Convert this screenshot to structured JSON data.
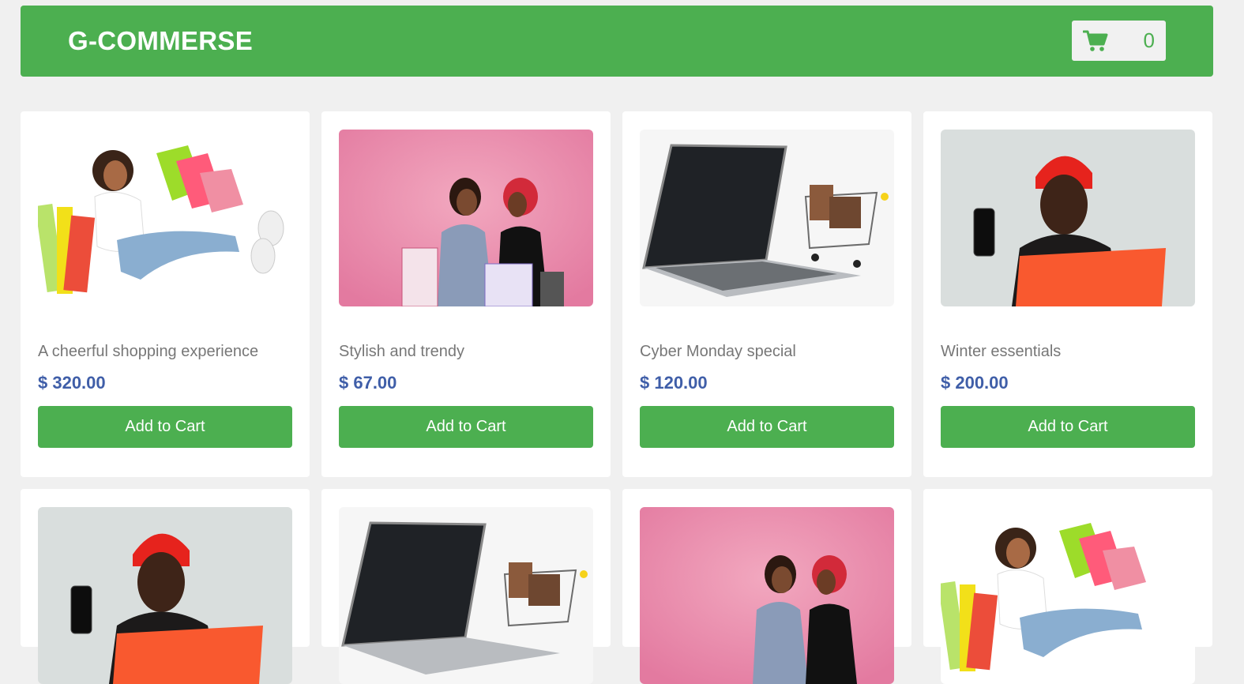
{
  "header": {
    "brand": "G-COMMERSE",
    "cart_icon": "shopping-cart-icon",
    "cart_count": "0"
  },
  "colors": {
    "primary": "#4caf50",
    "price": "#3f5ea8",
    "background": "#f0f0f0",
    "card": "#ffffff"
  },
  "products": [
    {
      "title": "A cheerful shopping experience",
      "price": "$ 320.00",
      "button": "Add to Cart",
      "image": "woman-with-shopping-bags"
    },
    {
      "title": "Stylish and trendy",
      "price": "$ 67.00",
      "button": "Add to Cart",
      "image": "two-women-pink-background"
    },
    {
      "title": "Cyber Monday special",
      "price": "$ 120.00",
      "button": "Add to Cart",
      "image": "laptop-with-shopping-cart"
    },
    {
      "title": "Winter essentials",
      "price": "$ 200.00",
      "button": "Add to Cart",
      "image": "woman-red-beanie-phone"
    },
    {
      "title": "",
      "price": "",
      "button": "",
      "image": "woman-red-beanie-phone"
    },
    {
      "title": "",
      "price": "",
      "button": "",
      "image": "laptop-with-shopping-cart"
    },
    {
      "title": "",
      "price": "",
      "button": "",
      "image": "two-women-pink-background"
    },
    {
      "title": "",
      "price": "",
      "button": "",
      "image": "woman-with-shopping-bags"
    }
  ]
}
